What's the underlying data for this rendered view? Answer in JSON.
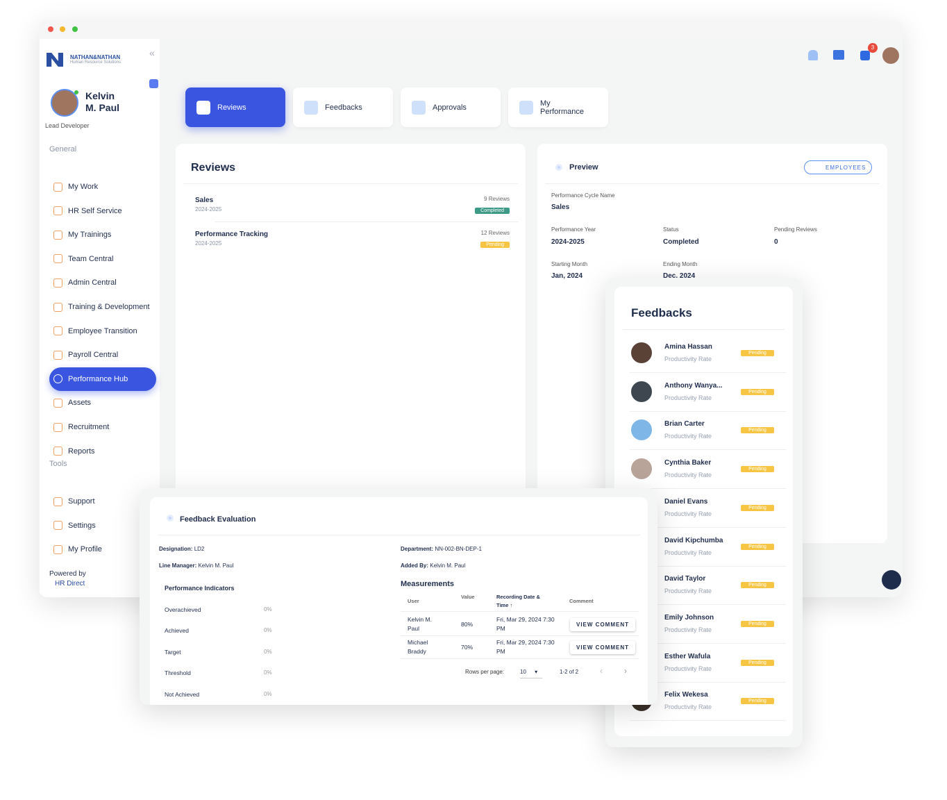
{
  "brand": {
    "name": "NATHAN&NATHAN",
    "tagline": "Human Resource Solutions"
  },
  "user": {
    "name": "Kelvin M. Paul",
    "first": "Kelvin",
    "last": "M. Paul",
    "role": "Lead Developer"
  },
  "sidebar": {
    "general_label": "General",
    "items": [
      {
        "label": "My Work",
        "icon": "list-icon"
      },
      {
        "label": "HR Self Service",
        "icon": "id-card-icon"
      },
      {
        "label": "My Trainings",
        "icon": "document-icon"
      },
      {
        "label": "Team Central",
        "icon": "users-icon"
      },
      {
        "label": "Admin Central",
        "icon": "grid-icon"
      },
      {
        "label": "Training & Development",
        "icon": "grid-icon"
      },
      {
        "label": "Employee Transition",
        "icon": "handshake-icon"
      },
      {
        "label": "Payroll Central",
        "icon": "document-icon"
      },
      {
        "label": "Performance Hub",
        "icon": "gauge-icon",
        "active": true
      },
      {
        "label": "Assets",
        "icon": "box-icon"
      },
      {
        "label": "Recruitment",
        "icon": "user-icon"
      },
      {
        "label": "Reports",
        "icon": "report-icon"
      }
    ],
    "tools_label": "Tools",
    "tools": [
      {
        "label": "Support",
        "icon": "headset-icon"
      },
      {
        "label": "Settings",
        "icon": "gear-icon"
      },
      {
        "label": "My Profile",
        "icon": "user-icon"
      }
    ],
    "powered_by": "Powered by",
    "powered_name": "HR Direct"
  },
  "topbar": {
    "notification_count": "3",
    "icons": [
      "home-icon",
      "book-icon",
      "chat-icon"
    ]
  },
  "tabs": [
    {
      "label": "Reviews",
      "active": true
    },
    {
      "label": "Feedbacks"
    },
    {
      "label": "Approvals"
    },
    {
      "label": "My Performance"
    }
  ],
  "reviews": {
    "title": "Reviews",
    "items": [
      {
        "name": "Sales",
        "period": "2024-2025",
        "count": "9 Reviews",
        "status": "Completed",
        "color": "#3d9a86"
      },
      {
        "name": "Performance Tracking",
        "period": "2024-2025",
        "count": "12 Reviews",
        "status": "Pending",
        "color": "#f7c544"
      }
    ]
  },
  "preview": {
    "title": "Preview",
    "employees_button": "EMPLOYEES",
    "cycle_label": "Performance Cycle Name",
    "cycle": "Sales",
    "year_label": "Performance Year",
    "year": "2024-2025",
    "status_label": "Status",
    "status": "Completed",
    "pending_label": "Pending Reviews",
    "pending": "0",
    "start_label": "Starting Month",
    "start": "Jan, 2024",
    "end_label": "Ending Month",
    "end": "Dec, 2024"
  },
  "feedbacks": {
    "title": "Feedbacks",
    "items": [
      {
        "name": "Amina Hassan",
        "metric": "Productivity Rate",
        "status": "Pending"
      },
      {
        "name": "Anthony Wanya...",
        "metric": "Productivity Rate",
        "status": "Pending"
      },
      {
        "name": "Brian Carter",
        "metric": "Productivity Rate",
        "status": "Pending"
      },
      {
        "name": "Cynthia Baker",
        "metric": "Productivity Rate",
        "status": "Pending"
      },
      {
        "name": "Daniel Evans",
        "metric": "Productivity Rate",
        "status": "Pending"
      },
      {
        "name": "David Kipchumba",
        "metric": "Productivity Rate",
        "status": "Pending"
      },
      {
        "name": "David Taylor",
        "metric": "Productivity Rate",
        "status": "Pending"
      },
      {
        "name": "Emily Johnson",
        "metric": "Productivity Rate",
        "status": "Pending"
      },
      {
        "name": "Esther Wafula",
        "metric": "Productivity Rate",
        "status": "Pending"
      },
      {
        "name": "Felix Wekesa",
        "metric": "Productivity Rate",
        "status": "Pending"
      }
    ]
  },
  "evaluation": {
    "title": "Feedback Evaluation",
    "designation_label": "Designation:",
    "designation": "LD2",
    "manager_label": "Line Manager:",
    "manager": "Kelvin M. Paul",
    "department_label": "Department:",
    "department": "NN-002-BN-DEP-1",
    "added_label": "Added By:",
    "added": "Kelvin M. Paul",
    "indicators_title": "Performance Indicators",
    "indicators": [
      {
        "label": "Overachieved",
        "value": "0%"
      },
      {
        "label": "Achieved",
        "value": "0%"
      },
      {
        "label": "Target",
        "value": "0%"
      },
      {
        "label": "Threshold",
        "value": "0%"
      },
      {
        "label": "Not Achieved",
        "value": "0%"
      }
    ],
    "measurements_title": "Measurements",
    "columns": [
      "User",
      "Value",
      "Recording Date & Time ↑",
      "Comment"
    ],
    "rows": [
      {
        "user": "Kelvin M. Paul",
        "value": "80%",
        "date": "Fri, Mar 29, 2024 7:30 PM",
        "action": "VIEW COMMENT"
      },
      {
        "user": "Michael Braddy",
        "value": "70%",
        "date": "Fri, Mar 29, 2024 7:30 PM",
        "action": "VIEW COMMENT"
      }
    ],
    "rows_per_page_label": "Rows per page:",
    "rows_per_page": "10",
    "range": "1-2 of 2"
  }
}
